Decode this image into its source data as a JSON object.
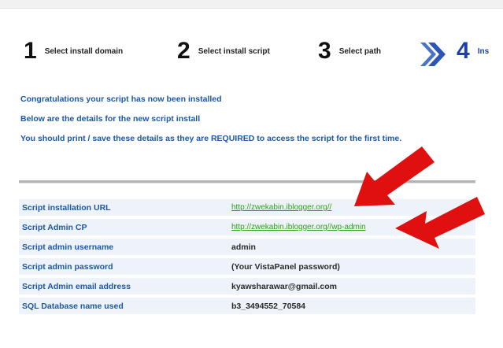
{
  "wizard": {
    "steps": [
      {
        "number": "1",
        "label": "Select install domain"
      },
      {
        "number": "2",
        "label": "Select install script"
      },
      {
        "number": "3",
        "label": "Select path"
      },
      {
        "number": "4",
        "label": "Ins"
      }
    ],
    "active_step": 4
  },
  "messages": [
    "Congratulations your script has now been installed",
    "Below are the details for the new script install",
    "You should print / save these details as they are REQUIRED to access the script for the first time."
  ],
  "details": [
    {
      "label": "Script installation URL",
      "value": "http://zwekabin.iblogger.org//"
    },
    {
      "label": "Script Admin CP",
      "value": "http://zwekabin.iblogger.org//wp-admin"
    },
    {
      "label": "Script admin username",
      "value": "admin"
    },
    {
      "label": "Script admin password",
      "value": "(Your VistaPanel password)"
    },
    {
      "label": "Script Admin email address",
      "value": "kyawsharawar@gmail.com"
    },
    {
      "label": "SQL Database name used",
      "value": "b3_3494552_70584"
    }
  ],
  "colors": {
    "heading_blue": "#1b57a8",
    "active_step_blue": "#1e3fb2",
    "link_green": "#2ea01a",
    "annotation_red": "#e01010"
  },
  "icons": {
    "step_arrow": "chevron-double-right-icon",
    "annotation": "red-pointer-arrow-icon"
  }
}
